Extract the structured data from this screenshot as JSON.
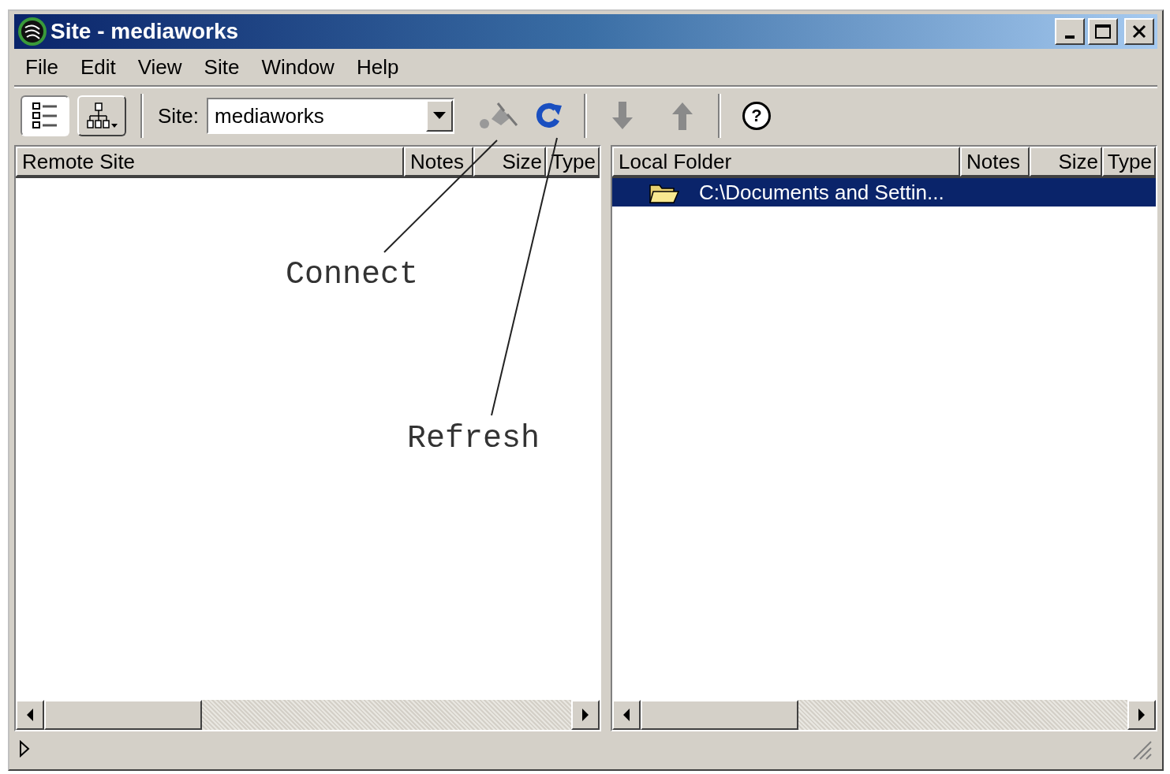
{
  "window": {
    "title": "Site - mediaworks"
  },
  "menu": [
    "File",
    "Edit",
    "View",
    "Site",
    "Window",
    "Help"
  ],
  "toolbar": {
    "site_label": "Site:",
    "site_value": "mediaworks",
    "help_glyph": "?"
  },
  "remote_pane": {
    "columns": [
      "Remote Site",
      "Notes",
      "Size",
      "Type"
    ]
  },
  "local_pane": {
    "columns": [
      "Local Folder",
      "Notes",
      "Size",
      "Type"
    ],
    "rows": [
      {
        "name": "C:\\Documents and Settin...",
        "selected": true
      }
    ]
  },
  "annotations": [
    {
      "label": "Connect",
      "kind": "connect"
    },
    {
      "label": "Refresh",
      "kind": "refresh"
    }
  ]
}
